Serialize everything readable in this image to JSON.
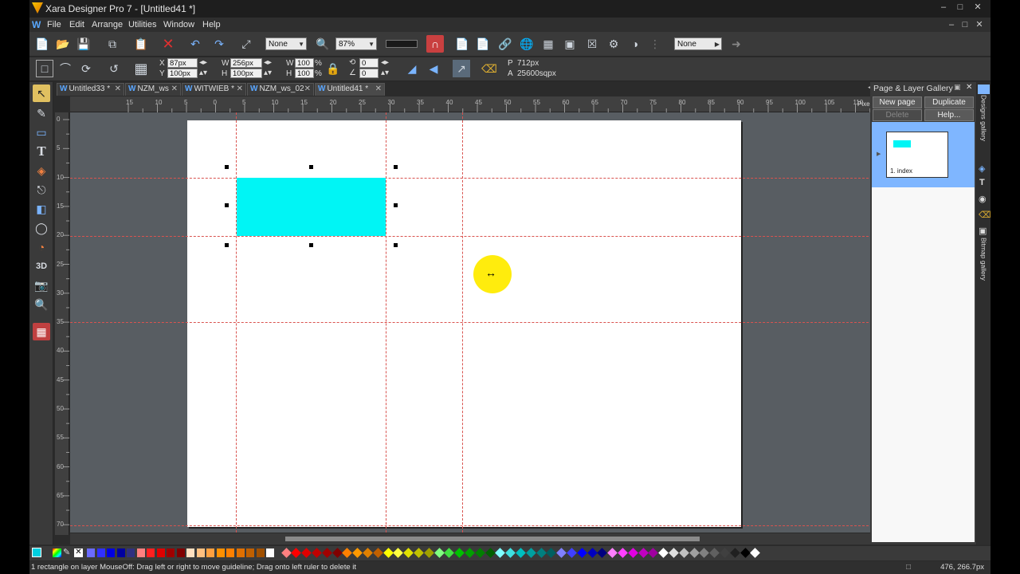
{
  "window": {
    "title": "Xara Designer Pro 7 - [Untitled41 *]",
    "controls": {
      "minimize": "–",
      "restore": "□",
      "close": "✕"
    }
  },
  "menu": {
    "logo": "W",
    "items": [
      "File",
      "Edit",
      "Arrange",
      "Utilities",
      "Window",
      "Help"
    ],
    "doc_controls": {
      "minimize": "–",
      "restore": "□",
      "close": "✕"
    }
  },
  "toolbar1": {
    "quality_combo": "None",
    "zoom_combo": "87%",
    "right_combo": "None"
  },
  "toolbar2": {
    "x_label": "X",
    "x_value": "87px",
    "y_label": "Y",
    "y_value": "100px",
    "w_label": "W",
    "w_value": "256px",
    "h_label": "H",
    "h_value": "100px",
    "sw_label": "W",
    "sw_value": "100",
    "sw_unit": "%",
    "sh_label": "H",
    "sh_value": "100",
    "sh_unit": "%",
    "rot_value": "0",
    "skew_value": "0",
    "p_label": "P",
    "p_value": "712px",
    "a_label": "A",
    "a_value": "25600sqpx"
  },
  "tabs": [
    {
      "label": "Untitled33 *",
      "active": false
    },
    {
      "label": "NZM_ws",
      "active": false
    },
    {
      "label": "WITWIEB *",
      "active": false
    },
    {
      "label": "NZM_ws_02",
      "active": false
    },
    {
      "label": "Untitled41 *",
      "active": true
    }
  ],
  "ruler": {
    "h_ticks": [
      "15",
      "10",
      "5",
      "0",
      "5",
      "10",
      "15",
      "20",
      "25",
      "30",
      "35",
      "40",
      "45",
      "50",
      "55",
      "60",
      "65",
      "70",
      "75",
      "80",
      "85",
      "90",
      "95",
      "100",
      "105",
      "110"
    ],
    "units": "Pixels × 10",
    "v_ticks": [
      "0",
      "5",
      "10",
      "15",
      "20",
      "25",
      "30",
      "35",
      "40",
      "45",
      "50",
      "55",
      "60",
      "65",
      "70"
    ]
  },
  "gallery": {
    "title": "Page & Layer Gallery",
    "buttons": {
      "new_page": "New page",
      "duplicate": "Duplicate",
      "delete": "Delete",
      "help": "Help..."
    },
    "page_label": "1. index"
  },
  "side_tabs": [
    "Designs gallery",
    "Bitmap gallery"
  ],
  "palette": {
    "swatches": [
      "#6b6bff",
      "#3030ff",
      "#0000e0",
      "#0000a0",
      "#303080",
      "#ff8080",
      "#ff2020",
      "#e00000",
      "#a00000",
      "#800000",
      "#ffe0c0",
      "#ffc080",
      "#ffa040",
      "#ff9000",
      "#ff8000",
      "#e07000",
      "#c06000",
      "#a05000",
      "#ffffff"
    ],
    "diamonds": [
      "#ff8080",
      "#ff0000",
      "#e00000",
      "#c00000",
      "#a00000",
      "#800000",
      "#ff8000",
      "#ff9900",
      "#e08000",
      "#c06000",
      "#ffff00",
      "#ffff40",
      "#e0e000",
      "#c0c000",
      "#a0a000",
      "#80ff80",
      "#40e040",
      "#00c000",
      "#00a000",
      "#008000",
      "#006000",
      "#80ffff",
      "#40e0e0",
      "#00c0c0",
      "#00a0a0",
      "#008080",
      "#006060",
      "#8080ff",
      "#4040ff",
      "#0000ff",
      "#0000c0",
      "#000080",
      "#ff80ff",
      "#ff40ff",
      "#e000e0",
      "#c000c0",
      "#a000a0",
      "#ffffff",
      "#e0e0e0",
      "#c0c0c0",
      "#a0a0a0",
      "#808080",
      "#606060",
      "#404040",
      "#202020",
      "#000000",
      "#ffffff"
    ]
  },
  "status": {
    "text": "1 rectangle on layer MouseOff: Drag left or right to move guideline; Drag onto left ruler to delete it",
    "coords": "476, 266.7px"
  },
  "colors": {
    "rectangle_fill": "#00f5f5",
    "guide": "#d9534f",
    "cursor": "#ffeb00",
    "gallery_selected": "#7fb6ff"
  },
  "icons": {
    "cursor": "horizontal-move-cursor-icon"
  }
}
